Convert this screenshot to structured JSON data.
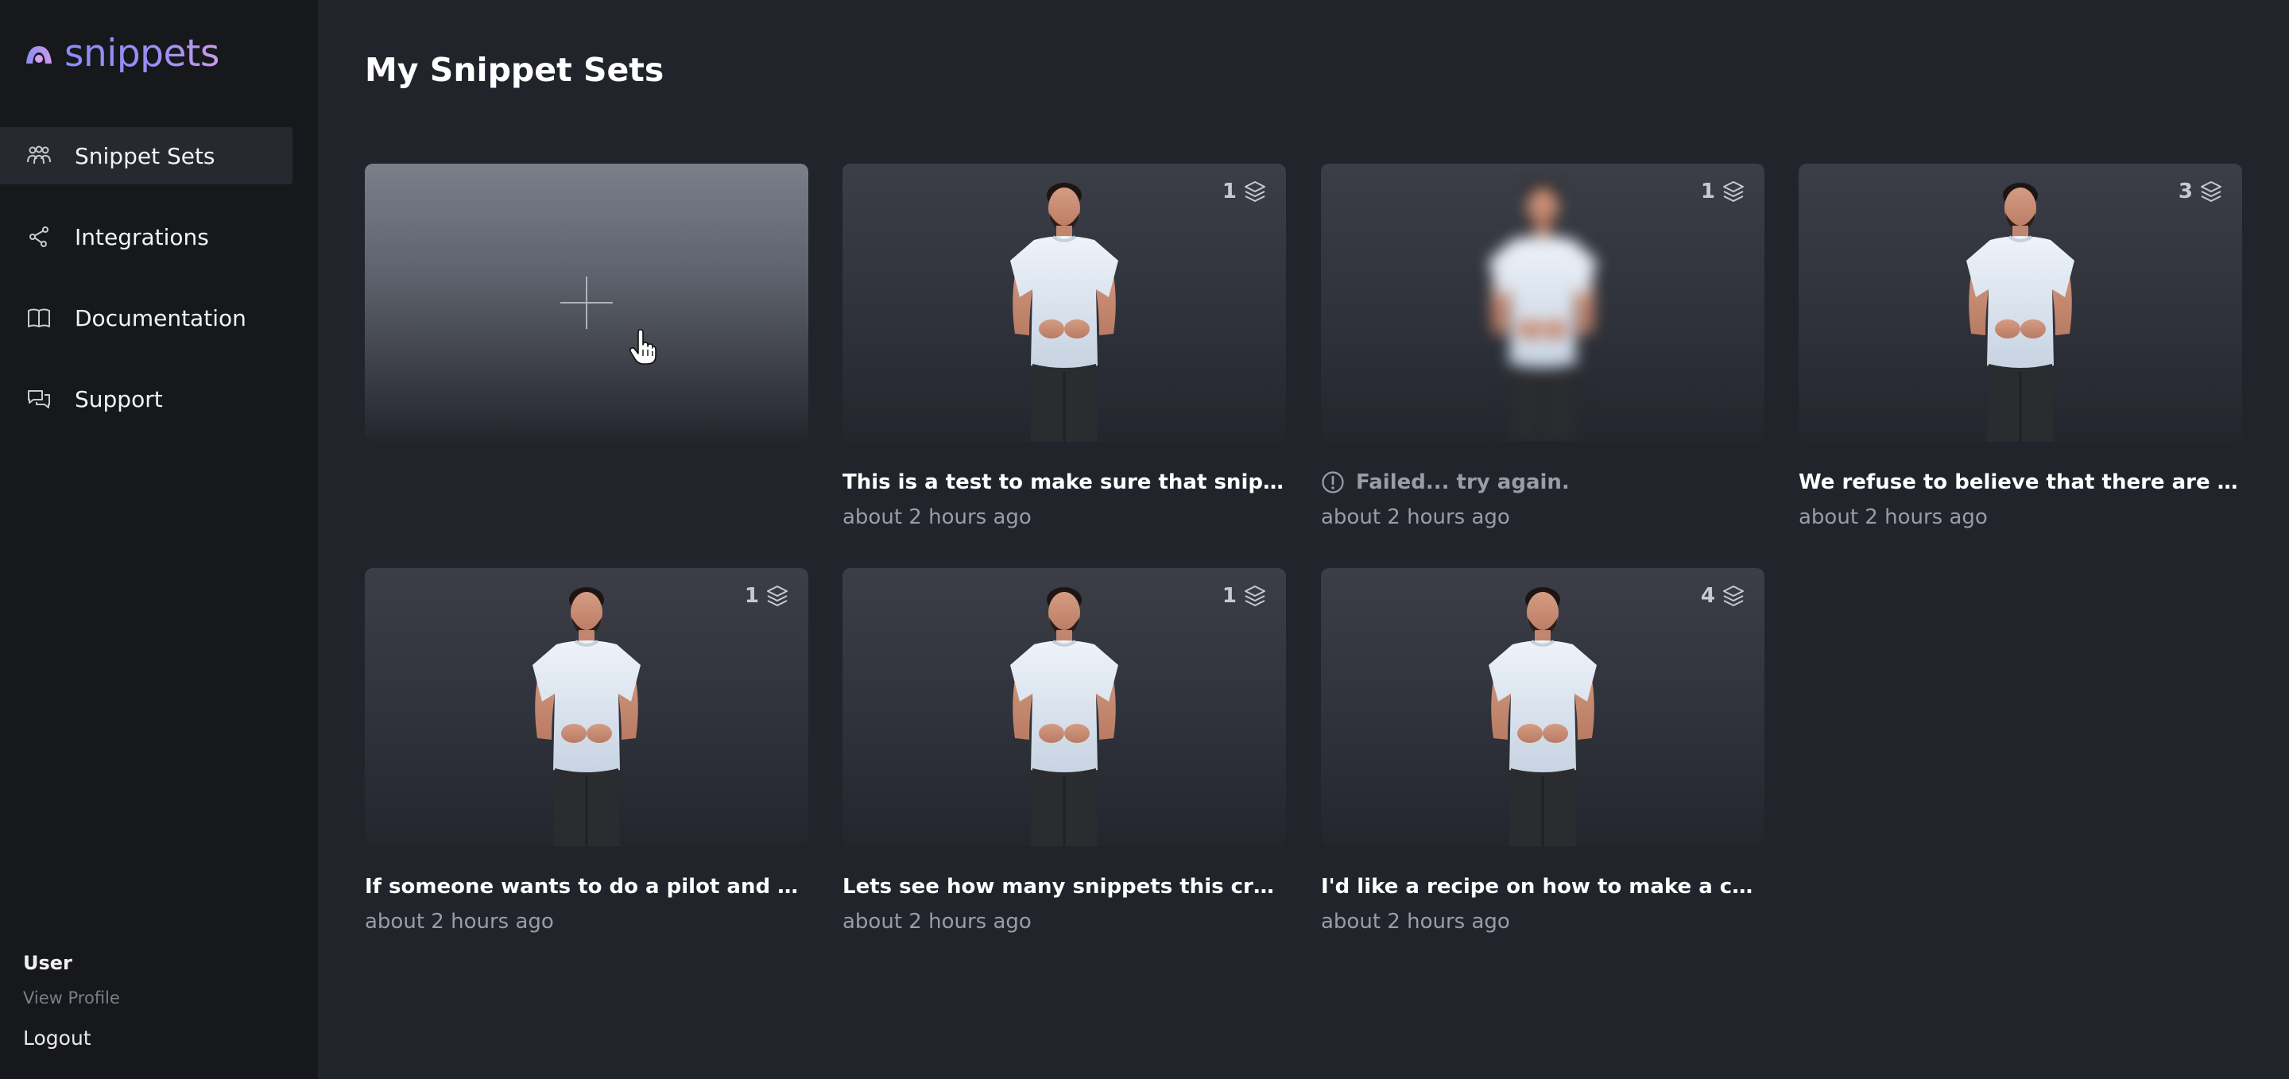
{
  "brand": {
    "name": "snippets"
  },
  "sidebar": {
    "items": [
      {
        "label": "Snippet Sets",
        "icon": "users-icon",
        "active": true
      },
      {
        "label": "Integrations",
        "icon": "share-icon",
        "active": false
      },
      {
        "label": "Documentation",
        "icon": "book-icon",
        "active": false
      },
      {
        "label": "Support",
        "icon": "chat-icon",
        "active": false
      }
    ],
    "user": {
      "name": "User",
      "view_profile": "View Profile",
      "logout": "Logout"
    }
  },
  "main": {
    "title": "My Snippet Sets",
    "cards": [
      {
        "title": "This is a test to make sure that snippet is working correctly",
        "time": "about 2 hours ago",
        "count": "1",
        "status": "ok"
      },
      {
        "title": "Failed... try again.",
        "time": "about 2 hours ago",
        "count": "1",
        "status": "failed"
      },
      {
        "title": "We refuse to believe that there are insufficient funds",
        "time": "about 2 hours ago",
        "count": "3",
        "status": "ok"
      },
      {
        "title": "If someone wants to do a pilot and has the time",
        "time": "about 2 hours ago",
        "count": "1",
        "status": "ok"
      },
      {
        "title": "Lets see how many snippets this creates!",
        "time": "about 2 hours ago",
        "count": "1",
        "status": "ok"
      },
      {
        "title": "I'd like a recipe on how to make a cake.",
        "time": "about 2 hours ago",
        "count": "4",
        "status": "ok"
      }
    ]
  },
  "colors": {
    "background": "#21242b",
    "sidebar": "#17181c",
    "accent": "#8a8df6"
  }
}
